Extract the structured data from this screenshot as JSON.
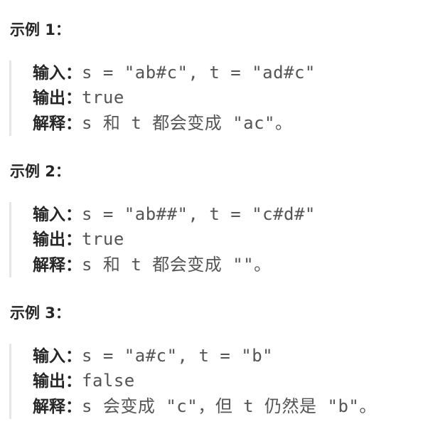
{
  "examples": [
    {
      "title": "示例 1：",
      "input_label": "输入：",
      "input_value": "s = \"ab#c\", t = \"ad#c\"",
      "output_label": "输出：",
      "output_value": "true",
      "explain_label": "解释：",
      "explain_value": "s 和 t 都会变成 \"ac\"。"
    },
    {
      "title": "示例 2：",
      "input_label": "输入：",
      "input_value": "s = \"ab##\", t = \"c#d#\"",
      "output_label": "输出：",
      "output_value": "true",
      "explain_label": "解释：",
      "explain_value": "s 和 t 都会变成 \"\"。"
    },
    {
      "title": "示例 3：",
      "input_label": "输入：",
      "input_value": "s = \"a#c\", t = \"b\"",
      "output_label": "输出：",
      "output_value": "false",
      "explain_label": "解释：",
      "explain_value": "s 会变成 \"c\"，但 t 仍然是 \"b\"。"
    }
  ]
}
